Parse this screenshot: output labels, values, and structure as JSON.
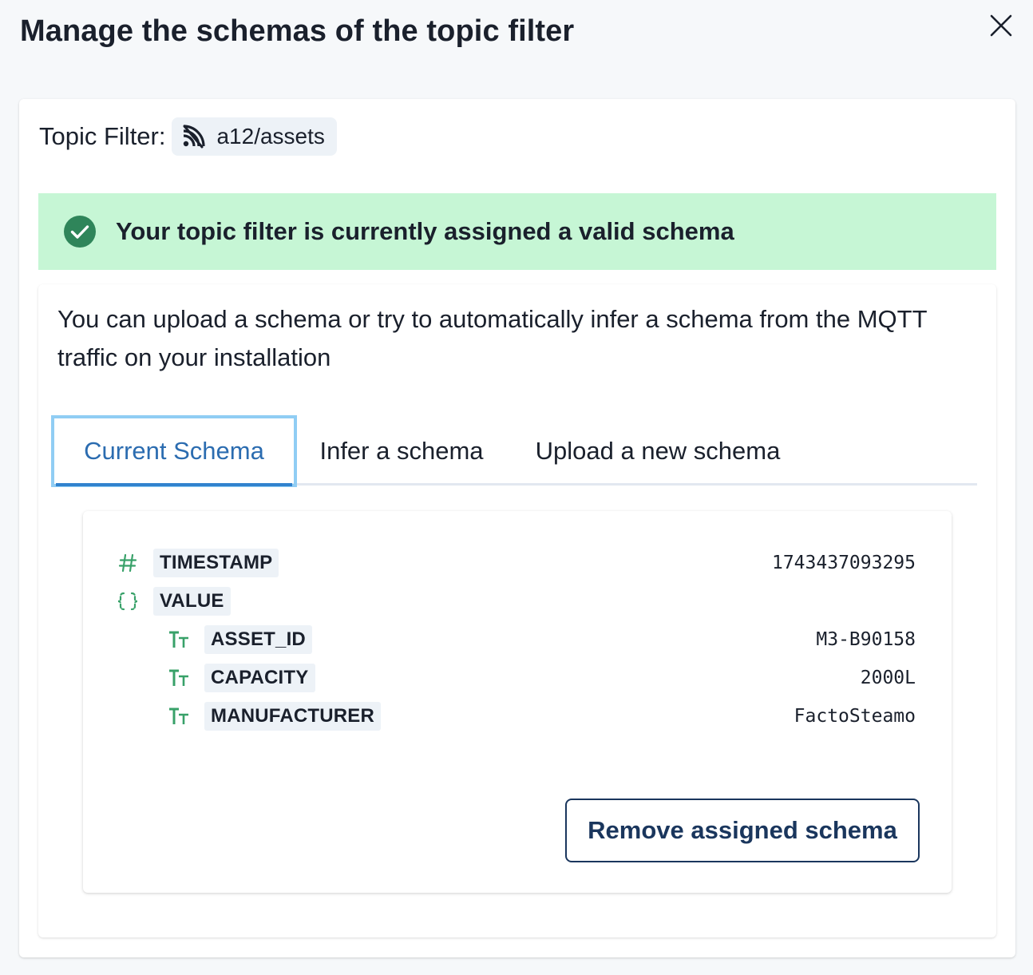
{
  "modal": {
    "title": "Manage the schemas of the topic filter"
  },
  "topic_filter": {
    "label": "Topic Filter:",
    "value": "a12/assets",
    "icon": "rss-feed-icon"
  },
  "alert": {
    "status": "success",
    "icon": "check-circle-icon",
    "message": "Your topic filter is currently assigned a valid schema",
    "background_color": "#c6f6d5",
    "icon_color": "#2f855a"
  },
  "description": "You can upload a schema or try to automatically infer a schema from the MQTT traffic on your installation",
  "tabs": [
    {
      "label": "Current Schema",
      "selected": true
    },
    {
      "label": "Infer a schema",
      "selected": false
    },
    {
      "label": "Upload a new schema",
      "selected": false
    }
  ],
  "schema": {
    "fields": [
      {
        "type_icon": "number-hash-icon",
        "name": "TIMESTAMP",
        "value": "1743437093295",
        "level": 0
      },
      {
        "type_icon": "object-braces-icon",
        "name": "VALUE",
        "value": "",
        "level": 0
      },
      {
        "type_icon": "string-text-icon",
        "name": "ASSET_ID",
        "value": "M3-B90158",
        "level": 1
      },
      {
        "type_icon": "string-text-icon",
        "name": "CAPACITY",
        "value": "2000L",
        "level": 1
      },
      {
        "type_icon": "string-text-icon",
        "name": "MANUFACTURER",
        "value": "FactoSteamo",
        "level": 1
      }
    ],
    "type_icon_color": "#38a169"
  },
  "actions": {
    "remove_label": "Remove assigned schema"
  },
  "colors": {
    "accent": "#3182ce",
    "active_tab_text": "#2b6cb0",
    "button_border": "#1a365d"
  }
}
